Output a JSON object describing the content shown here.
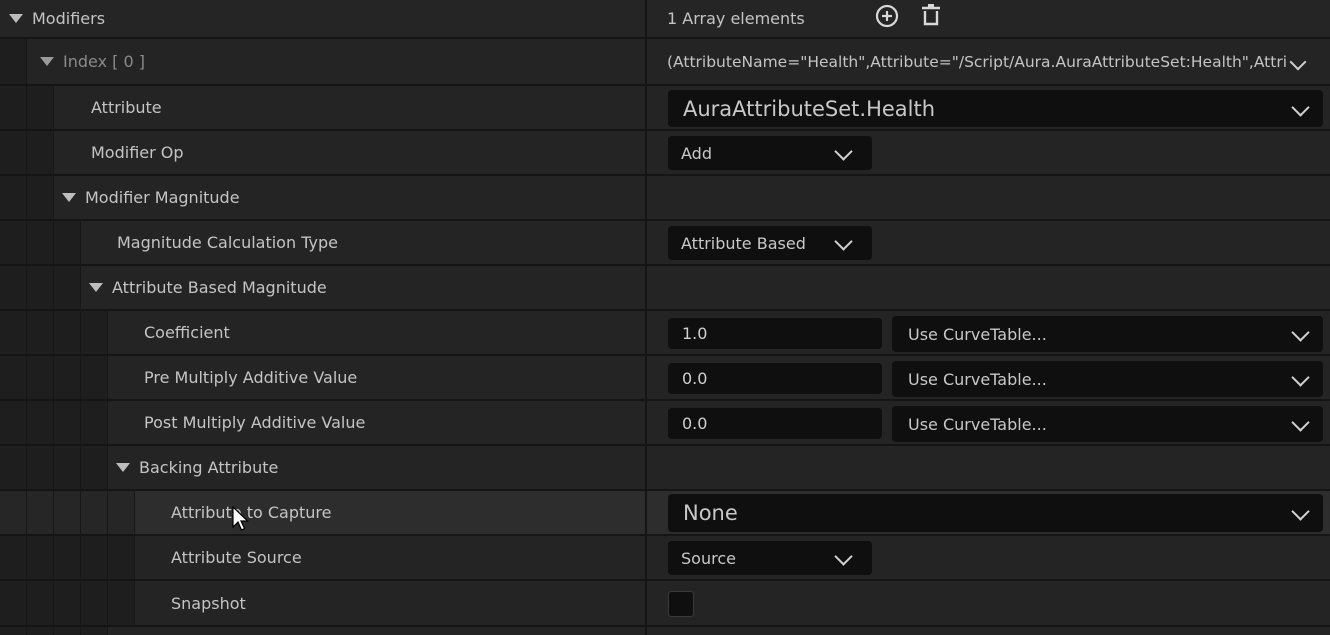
{
  "modifiers": {
    "label": "Modifiers",
    "count_text": "1 Array elements",
    "add_icon": "plus-circle-icon",
    "delete_icon": "trash-icon"
  },
  "index": {
    "label": "Index [ 0 ]",
    "summary": "(AttributeName=\"Health\",Attribute=\"/Script/Aura.AuraAttributeSet:Health\",Attri"
  },
  "attribute": {
    "label": "Attribute",
    "value": "AuraAttributeSet.Health"
  },
  "modifier_op": {
    "label": "Modifier Op",
    "value": "Add"
  },
  "modifier_magnitude": {
    "label": "Modifier Magnitude"
  },
  "magnitude_calc_type": {
    "label": "Magnitude Calculation Type",
    "value": "Attribute Based"
  },
  "attribute_based_magnitude": {
    "label": "Attribute Based Magnitude"
  },
  "coefficient": {
    "label": "Coefficient",
    "value": "1.0",
    "curve": "Use CurveTable..."
  },
  "pre_multiply": {
    "label": "Pre Multiply Additive Value",
    "value": "0.0",
    "curve": "Use CurveTable..."
  },
  "post_multiply": {
    "label": "Post Multiply Additive Value",
    "value": "0.0",
    "curve": "Use CurveTable..."
  },
  "backing_attribute": {
    "label": "Backing Attribute"
  },
  "attribute_to_capture": {
    "label": "Attribute to Capture",
    "value": "None"
  },
  "attribute_source": {
    "label": "Attribute Source",
    "value": "Source"
  },
  "snapshot": {
    "label": "Snapshot",
    "checked": false
  }
}
